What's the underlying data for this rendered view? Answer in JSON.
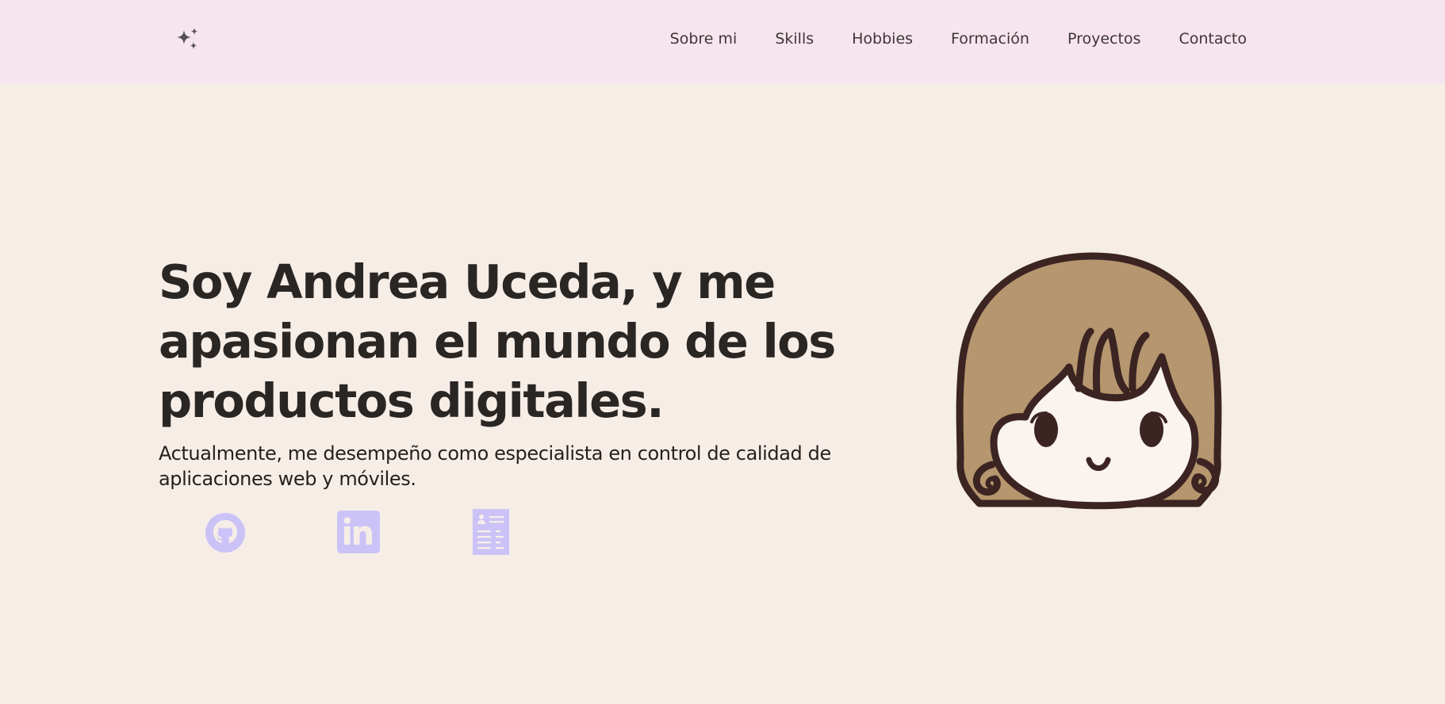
{
  "header": {
    "logo_icon": "sparkles-icon",
    "nav": [
      {
        "label": "Sobre mi"
      },
      {
        "label": "Skills"
      },
      {
        "label": "Hobbies"
      },
      {
        "label": "Formación"
      },
      {
        "label": "Proyectos"
      },
      {
        "label": "Contacto"
      }
    ]
  },
  "hero": {
    "title": "Soy Andrea Uceda, y me apasionan el mundo de los productos digitales.",
    "subtitle": "Actualmente, me desempeño como especialista en control de calidad de aplicaciones web y móviles.",
    "socials": [
      {
        "icon": "github-icon"
      },
      {
        "icon": "linkedin-icon"
      },
      {
        "icon": "resume-icon"
      }
    ],
    "avatar_icon": "girl-avatar-illustration"
  },
  "colors": {
    "header_bg": "#f6e4ee",
    "page_bg": "#f6ede7",
    "icon_accent": "#cbc3f7",
    "hair": "#b5966e",
    "outline": "#3b2422",
    "skin": "#fbf3ef"
  }
}
